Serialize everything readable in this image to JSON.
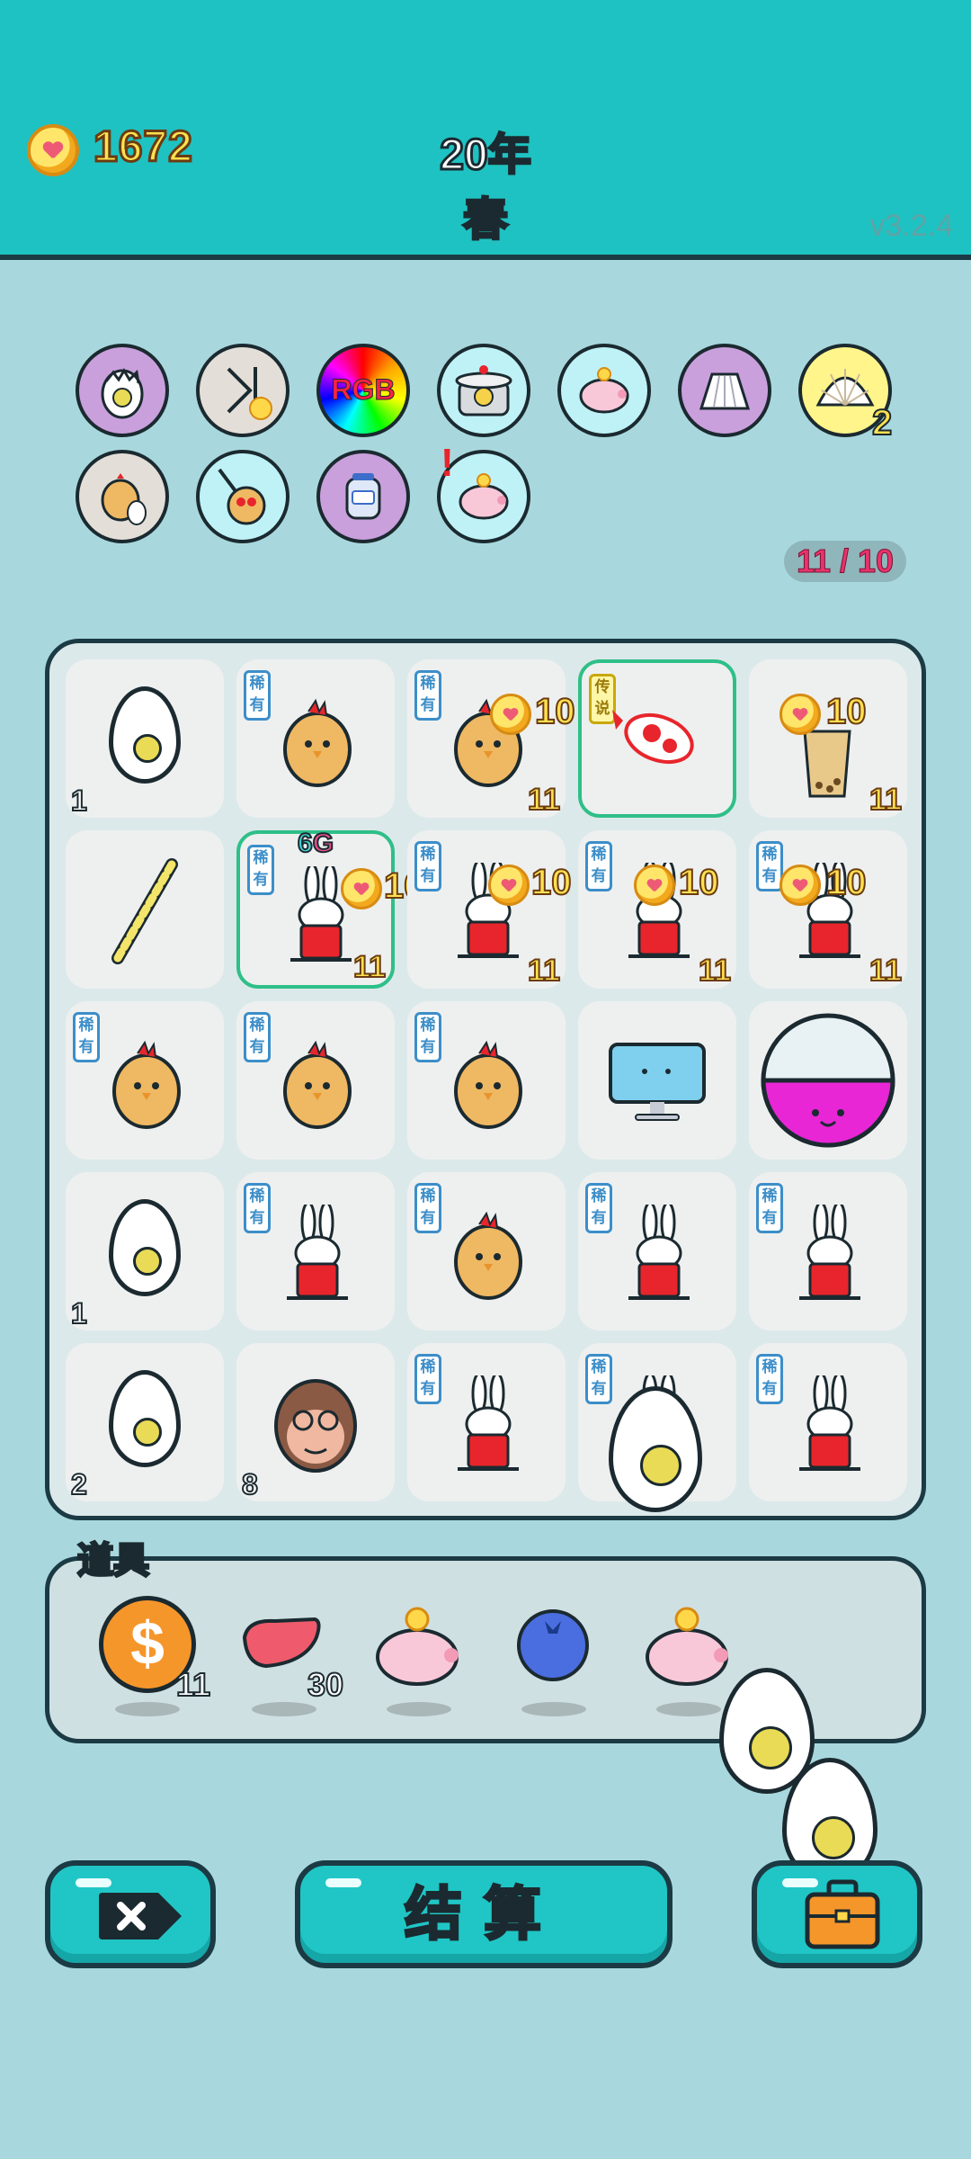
{
  "header": {
    "coins": "1672",
    "year": "20年",
    "season": "春",
    "version": "v3.2.4"
  },
  "relics": {
    "shell_count": "2",
    "counter": "11 / 10",
    "alert": "!"
  },
  "board": {
    "rare_label": "稀有",
    "legend_label": "传说",
    "coin_bonus": "10",
    "count_eleven": "11",
    "sixg_prefix": "6",
    "sixg_suffix": "G",
    "egg_count_r1": "1",
    "egg_count_r4": "1",
    "egg_count_r5": "2",
    "monkey_count": "8"
  },
  "items": {
    "label": "道具",
    "coin_count": "11",
    "liver_count": "30"
  },
  "buttons": {
    "settle": "结算"
  },
  "colors": {
    "header_bg": "#1fc2c2",
    "board_bg": "#dce9ea",
    "page_bg": "#a8d8de",
    "coin_yellow": "#ffe14f",
    "season_green": "#2bd64b",
    "counter_text": "#e8336b"
  }
}
